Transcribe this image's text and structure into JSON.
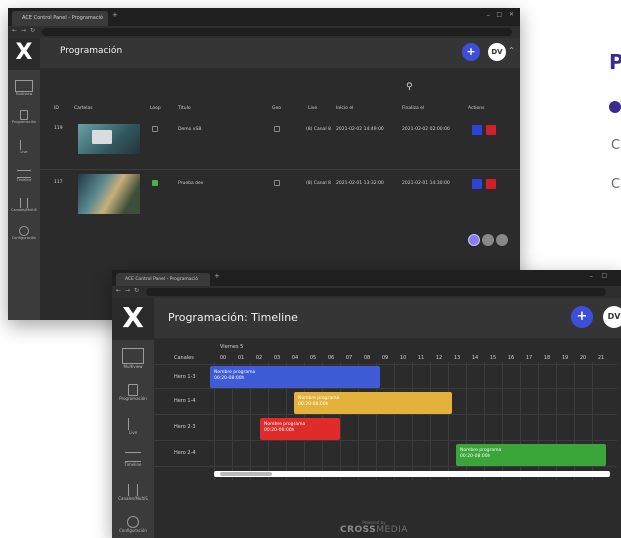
{
  "side_page": {
    "title": "P",
    "lines": [
      "C",
      "C"
    ]
  },
  "window1": {
    "tab_title": "ACE Control Panel - Programació",
    "app_title": "Programación",
    "user_initials": "DV",
    "add_label": "+",
    "sidebar": [
      "Multiview",
      "Programación",
      "Live",
      "Timeline",
      "Canales/MultiS",
      "Configuración"
    ],
    "columns": [
      "ID",
      "Cartelas",
      "Loop",
      "Título",
      "Geo",
      "Live",
      "Inicio el",
      "Finaliza el",
      "Actions"
    ],
    "rows": [
      {
        "id": "119",
        "loop": false,
        "title": "Demo vSB",
        "geo": false,
        "live": "(8) Canal 8",
        "start": "2021-02-02 14:49:00",
        "end": "2021-02-02 02:00:00"
      },
      {
        "id": "117",
        "loop": true,
        "title": "Prueba dev",
        "geo": false,
        "live": "(8) Canal 8",
        "start": "2021-02-01 13:32:00",
        "end": "2021-02-01 14:30:00"
      }
    ]
  },
  "window2": {
    "tab_title": "ACE Control Panel - Programació",
    "app_title": "Programación: Timeline",
    "user_initials": "DV",
    "add_label": "+",
    "sidebar": [
      "Multiview",
      "Programación",
      "Live",
      "Timeline",
      "Canales/MultiS",
      "Configuración"
    ],
    "day_label": "Viernes 5",
    "channels_label": "Canales",
    "hours": [
      "00",
      "01",
      "02",
      "03",
      "04",
      "05",
      "06",
      "07",
      "08",
      "09",
      "10",
      "11",
      "12",
      "13",
      "14",
      "15",
      "16",
      "17",
      "18",
      "19",
      "20",
      "21"
    ],
    "channels": [
      "Hero 1-3",
      "Hero 1-4",
      "Hero 2-3",
      "Hero 2-4"
    ],
    "programs": [
      {
        "name": "Nombre programa",
        "time": "00:20-08:00h",
        "color": "#3f5bd6"
      },
      {
        "name": "Nombre programa",
        "time": "00:20-08:00h",
        "color": "#e3b23c"
      },
      {
        "name": "Nombre programa",
        "time": "00:20-08:00h",
        "color": "#e02b2b"
      },
      {
        "name": "Nombre programa",
        "time": "00:20-08:00h",
        "color": "#3aa63a"
      }
    ],
    "footer_small": "Powered by",
    "footer_brand_bold": "CROSS",
    "footer_brand_light": "MEDIA"
  },
  "colors": {
    "accent_purple": "#3a2b8c",
    "add_button": "#3d4fd8",
    "edit_action": "#2d44d8",
    "delete_action": "#d31f2a",
    "loop_checked": "#4ab04a",
    "pagination_active": "#8a7cf0"
  },
  "icons": [
    "grid-icon",
    "calendar-icon",
    "list-icon",
    "timeline-icon",
    "channels-icon",
    "gear-icon",
    "search-icon",
    "pencil-icon",
    "trash-icon"
  ]
}
